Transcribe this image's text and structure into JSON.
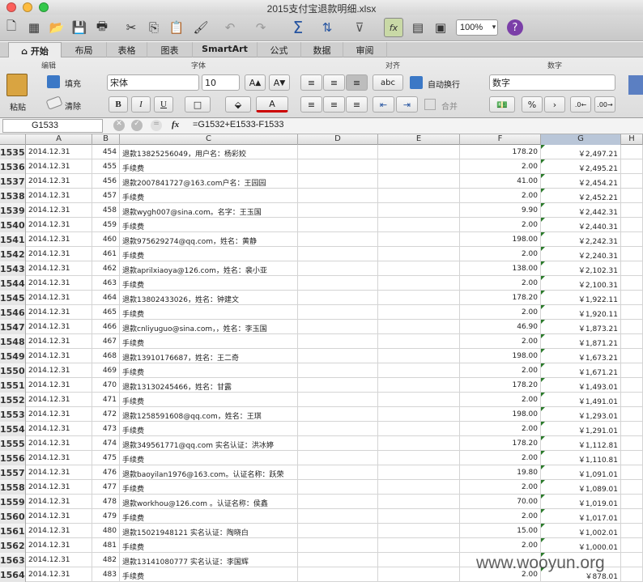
{
  "window": {
    "title": "2015支付宝退款明细.xlsx"
  },
  "toolbar": {
    "zoom": "100%"
  },
  "tabs": [
    "开始",
    "布局",
    "表格",
    "图表",
    "SmartArt",
    "公式",
    "数据",
    "审阅"
  ],
  "ribbon": {
    "edit_group": "编辑",
    "font_group": "字体",
    "align_group": "对齐",
    "number_group": "数字",
    "paste": "粘贴",
    "fill": "填充",
    "clear": "清除",
    "font_name": "宋体",
    "font_size": "10",
    "bold": "B",
    "italic": "I",
    "underline": "U",
    "wrap": "自动换行",
    "merge": "合并",
    "abc": "abc",
    "number_format": "数字",
    "percent": "%"
  },
  "formula_bar": {
    "name_box": "G1533",
    "fx": "fx",
    "formula": "=G1532+E1533-F1533"
  },
  "columns": [
    "A",
    "B",
    "C",
    "D",
    "E",
    "F",
    "G",
    "H"
  ],
  "rows": [
    {
      "n": "1535",
      "a": "2014.12.31",
      "b": "454",
      "c": "退款13825256049，用户名：杨彩姣",
      "f": "178.20",
      "g": "￥2,497.21"
    },
    {
      "n": "1536",
      "a": "2014.12.31",
      "b": "455",
      "c": "手续费",
      "f": "2.00",
      "g": "￥2,495.21"
    },
    {
      "n": "1537",
      "a": "2014.12.31",
      "b": "456",
      "c": "退款2007841727@163.com户名：王园园",
      "f": "41.00",
      "g": "￥2,454.21"
    },
    {
      "n": "1538",
      "a": "2014.12.31",
      "b": "457",
      "c": "手续费",
      "f": "2.00",
      "g": "￥2,452.21"
    },
    {
      "n": "1539",
      "a": "2014.12.31",
      "b": "458",
      "c": "退款wygh007@sina.com。名字：王玉国",
      "f": "9.90",
      "g": "￥2,442.31"
    },
    {
      "n": "1540",
      "a": "2014.12.31",
      "b": "459",
      "c": "手续费",
      "f": "2.00",
      "g": "￥2,440.31"
    },
    {
      "n": "1541",
      "a": "2014.12.31",
      "b": "460",
      "c": "退款975629274@qq.com，姓名：黄静",
      "f": "198.00",
      "g": "￥2,242.31"
    },
    {
      "n": "1542",
      "a": "2014.12.31",
      "b": "461",
      "c": "手续费",
      "f": "2.00",
      "g": "￥2,240.31"
    },
    {
      "n": "1543",
      "a": "2014.12.31",
      "b": "462",
      "c": "退款aprilxiaoya@126.com，姓名：裴小亚",
      "f": "138.00",
      "g": "￥2,102.31"
    },
    {
      "n": "1544",
      "a": "2014.12.31",
      "b": "463",
      "c": "手续费",
      "f": "2.00",
      "g": "￥2,100.31"
    },
    {
      "n": "1545",
      "a": "2014.12.31",
      "b": "464",
      "c": "退款13802433026，姓名：钟建文",
      "f": "178.20",
      "g": "￥1,922.11"
    },
    {
      "n": "1546",
      "a": "2014.12.31",
      "b": "465",
      "c": "手续费",
      "f": "2.00",
      "g": "￥1,920.11"
    },
    {
      "n": "1547",
      "a": "2014.12.31",
      "b": "466",
      "c": "退款cnliyuguo@sina.com，，姓名：李玉国",
      "f": "46.90",
      "g": "￥1,873.21"
    },
    {
      "n": "1548",
      "a": "2014.12.31",
      "b": "467",
      "c": "手续费",
      "f": "2.00",
      "g": "￥1,871.21"
    },
    {
      "n": "1549",
      "a": "2014.12.31",
      "b": "468",
      "c": "退款13910176687，姓名：王二奇",
      "f": "198.00",
      "g": "￥1,673.21"
    },
    {
      "n": "1550",
      "a": "2014.12.31",
      "b": "469",
      "c": "手续费",
      "f": "2.00",
      "g": "￥1,671.21"
    },
    {
      "n": "1551",
      "a": "2014.12.31",
      "b": "470",
      "c": "退款13130245466，姓名：甘露",
      "f": "178.20",
      "g": "￥1,493.01"
    },
    {
      "n": "1552",
      "a": "2014.12.31",
      "b": "471",
      "c": "手续费",
      "f": "2.00",
      "g": "￥1,491.01"
    },
    {
      "n": "1553",
      "a": "2014.12.31",
      "b": "472",
      "c": "退款1258591608@qq.com，姓名：王琪",
      "f": "198.00",
      "g": "￥1,293.01"
    },
    {
      "n": "1554",
      "a": "2014.12.31",
      "b": "473",
      "c": "手续费",
      "f": "2.00",
      "g": "￥1,291.01"
    },
    {
      "n": "1555",
      "a": "2014.12.31",
      "b": "474",
      "c": "退款349561771@qq.com  实名认证：洪冰婷",
      "f": "178.20",
      "g": "￥1,112.81"
    },
    {
      "n": "1556",
      "a": "2014.12.31",
      "b": "475",
      "c": "手续费",
      "f": "2.00",
      "g": "￥1,110.81"
    },
    {
      "n": "1557",
      "a": "2014.12.31",
      "b": "476",
      "c": "退款baoyilan1976@163.com。认证名称：跃荣",
      "f": "19.80",
      "g": "￥1,091.01"
    },
    {
      "n": "1558",
      "a": "2014.12.31",
      "b": "477",
      "c": "手续费",
      "f": "2.00",
      "g": "￥1,089.01"
    },
    {
      "n": "1559",
      "a": "2014.12.31",
      "b": "478",
      "c": "退款workhou@126.com 。认证名称：侯鑫",
      "f": "70.00",
      "g": "￥1,019.01"
    },
    {
      "n": "1560",
      "a": "2014.12.31",
      "b": "479",
      "c": "手续费",
      "f": "2.00",
      "g": "￥1,017.01"
    },
    {
      "n": "1561",
      "a": "2014.12.31",
      "b": "480",
      "c": "退款15021948121 实名认证：陶晓白",
      "f": "15.00",
      "g": "￥1,002.01"
    },
    {
      "n": "1562",
      "a": "2014.12.31",
      "b": "481",
      "c": "手续费",
      "f": "2.00",
      "g": "￥1,000.01"
    },
    {
      "n": "1563",
      "a": "2014.12.31",
      "b": "482",
      "c": "退款13141080777 实名认证：李国辉",
      "f": "",
      "g": ""
    },
    {
      "n": "1564",
      "a": "2014.12.31",
      "b": "483",
      "c": "手续费",
      "f": "2.00",
      "g": "￥878.01"
    }
  ],
  "watermark": "www.wooyun.org"
}
